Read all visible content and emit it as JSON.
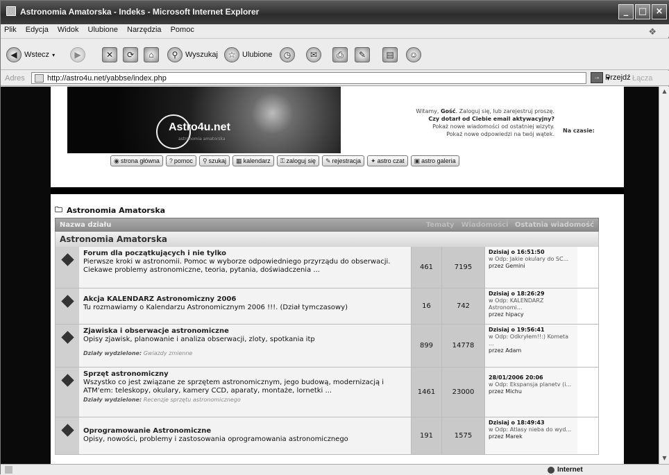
{
  "window": {
    "title": "Astronomia Amatorska - Indeks - Microsoft Internet Explorer",
    "controls": [
      "_",
      "□",
      "×"
    ]
  },
  "menubar": [
    "Plik",
    "Edycja",
    "Widok",
    "Ulubione",
    "Narzędzia",
    "Pomoc"
  ],
  "toolbar": {
    "back": "Wstecz",
    "search": "Wyszukaj",
    "favorites": "Ulubione"
  },
  "address": {
    "label": "Adres",
    "url": "http://astro4u.net/yabbse/index.php",
    "go": "Przejdź",
    "links": "Łącza"
  },
  "banner": {
    "logo": "Astro4u.net",
    "tagline": "astronomia amatorska"
  },
  "welcome": {
    "greeting": "Witamy,",
    "user": "Gość",
    "login_text": "Zaloguj się, lub zarejestruj proszę.",
    "activation": "Czy dotarł od Ciebie email aktywacyjny?",
    "line3": "Pokaż nowe wiadomości od ostatniej wizyty.",
    "line4": "Pokaż nowe odpowiedzi na twój wątek.",
    "time_label": "Na czasie:"
  },
  "nav_buttons": [
    "strona główna",
    "pomoc",
    "szukaj",
    "kalendarz",
    "zaloguj się",
    "rejestracja",
    "astro czat",
    "astro galeria"
  ],
  "forum": {
    "breadcrumb": "Astronomia Amatorska",
    "header": {
      "col_name": "Nazwa działu",
      "col_topics": "Tematy",
      "col_posts": "Wiadomości",
      "col_last": "Ostatnia wiadomość"
    },
    "category": "Astronomia Amatorska",
    "boards": [
      {
        "name": "Forum dla początkujących i nie tylko",
        "desc": "Pierwsze kroki w astronomii. Pomoc w wyborze odpowiedniego przyrządu do obserwacji. Ciekawe problemy astronomiczne, teoria, pytania, doświadczenia ...",
        "sub": "",
        "topics": "461",
        "posts": "7195",
        "last_date": "Dzisiaj o 16:51:50",
        "last_subject": "w Odp: Jakie okulary do SC...",
        "last_by": "przez Gemini"
      },
      {
        "name": "Akcja KALENDARZ Astronomiczny 2006",
        "desc": "Tu rozmawiamy o Kalendarzu Astronomicznym 2006 !!!. (Dział tymczasowy)",
        "sub": "",
        "topics": "16",
        "posts": "742",
        "last_date": "Dzisiaj o 18:26:29",
        "last_subject": "w Odp: KALENDARZ Astronomi...",
        "last_by": "przez hipacy"
      },
      {
        "name": "Zjawiska i obserwacje astronomiczne",
        "desc": "Opisy zjawisk, planowanie i analiza obserwacji, zloty, spotkania itp",
        "sub_label": "Działy wydzielone:",
        "sub": "Gwiazdy zmienne",
        "topics": "899",
        "posts": "14778",
        "last_date": "Dzisiaj o 19:56:41",
        "last_subject": "w Odp: Odkryłem!!:) Kometa ...",
        "last_by": "przez Adam"
      },
      {
        "name": "Sprzęt astronomiczny",
        "desc": "Wszystko co jest związane ze sprzętem astronomicznym, jego budową, modernizacją i ATM'em: teleskopy, okulary, kamery CCD, aparaty, montaże, lornetki ...",
        "sub_label": "Działy wydzielone:",
        "sub": "Recenzje sprzętu astronomicznego",
        "topics": "1461",
        "posts": "23000",
        "last_date": "28/01/2006 20:06",
        "last_subject": "w Odp: Ekspansja planetv (i...",
        "last_by": "przez Michu"
      },
      {
        "name": "Oprogramowanie Astronomiczne",
        "desc": "Opisy, nowości, problemy i zastosowania oprogramowania astronomicznego",
        "sub": "",
        "topics": "191",
        "posts": "1575",
        "last_date": "Dzisiaj o 18:49:43",
        "last_subject": "w Odp: Atlasy nieba do wyd...",
        "last_by": "przez Marek"
      }
    ]
  },
  "status": {
    "zone": "Internet"
  }
}
